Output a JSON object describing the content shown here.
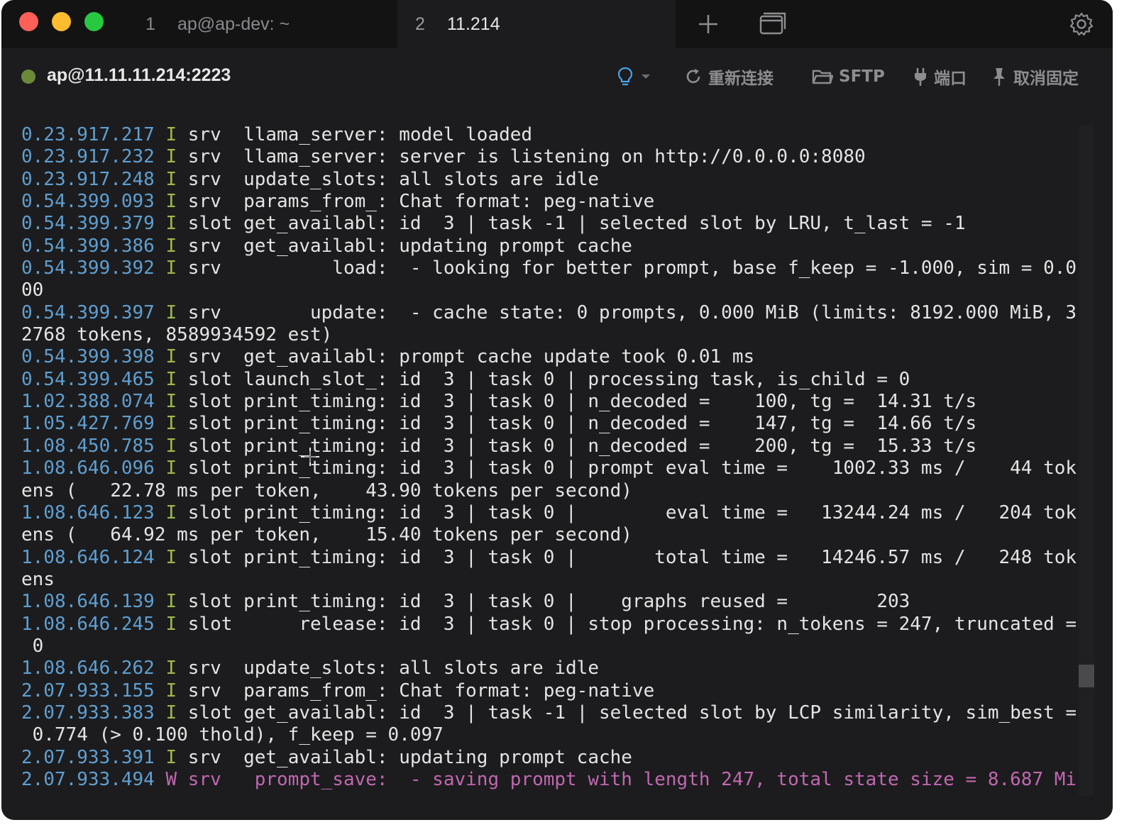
{
  "tabs": [
    {
      "number": "1",
      "title": "ap@ap-dev: ~"
    },
    {
      "number": "2",
      "title": "11.214"
    }
  ],
  "session": {
    "host": "ap@11.11.11.214:2223",
    "status_color": "#6a8a3a"
  },
  "toolbar": {
    "reconnect": "重新连接",
    "sftp": "SFTP",
    "port": "端口",
    "unpin": "取消固定"
  },
  "colors": {
    "timestamp": "#5f9fd1",
    "level_info": "#9fb84a",
    "warning": "#c167b0",
    "text": "#e4e4e4"
  },
  "terminal": {
    "lines": [
      {
        "ts": "0.23.917.217",
        "lvl": "I",
        "msg": " srv  llama_server: model loaded"
      },
      {
        "ts": "0.23.917.232",
        "lvl": "I",
        "msg": " srv  llama_server: server is listening on http://0.0.0.0:8080"
      },
      {
        "ts": "0.23.917.248",
        "lvl": "I",
        "msg": " srv  update_slots: all slots are idle"
      },
      {
        "ts": "0.54.399.093",
        "lvl": "I",
        "msg": " srv  params_from_: Chat format: peg-native"
      },
      {
        "ts": "0.54.399.379",
        "lvl": "I",
        "msg": " slot get_availabl: id  3 | task -1 | selected slot by LRU, t_last = -1"
      },
      {
        "ts": "0.54.399.386",
        "lvl": "I",
        "msg": " srv  get_availabl: updating prompt cache"
      },
      {
        "ts": "0.54.399.392",
        "lvl": "I",
        "msg": " srv          load:  - looking for better prompt, base f_keep = -1.000, sim = 0.0"
      },
      {
        "ts": "",
        "lvl": "",
        "msg": "00"
      },
      {
        "ts": "0.54.399.397",
        "lvl": "I",
        "msg": " srv        update:  - cache state: 0 prompts, 0.000 MiB (limits: 8192.000 MiB, 3"
      },
      {
        "ts": "",
        "lvl": "",
        "msg": "2768 tokens, 8589934592 est)"
      },
      {
        "ts": "0.54.399.398",
        "lvl": "I",
        "msg": " srv  get_availabl: prompt cache update took 0.01 ms"
      },
      {
        "ts": "0.54.399.465",
        "lvl": "I",
        "msg": " slot launch_slot_: id  3 | task 0 | processing task, is_child = 0"
      },
      {
        "ts": "1.02.388.074",
        "lvl": "I",
        "msg": " slot print_timing: id  3 | task 0 | n_decoded =    100, tg =  14.31 t/s"
      },
      {
        "ts": "1.05.427.769",
        "lvl": "I",
        "msg": " slot print_timing: id  3 | task 0 | n_decoded =    147, tg =  14.66 t/s"
      },
      {
        "ts": "1.08.450.785",
        "lvl": "I",
        "msg": " slot print_timing: id  3 | task 0 | n_decoded =    200, tg =  15.33 t/s"
      },
      {
        "ts": "1.08.646.096",
        "lvl": "I",
        "msg": " slot print_timing: id  3 | task 0 | prompt eval time =    1002.33 ms /    44 tok"
      },
      {
        "ts": "",
        "lvl": "",
        "msg": "ens (   22.78 ms per token,    43.90 tokens per second)"
      },
      {
        "ts": "1.08.646.123",
        "lvl": "I",
        "msg": " slot print_timing: id  3 | task 0 |        eval time =   13244.24 ms /   204 tok"
      },
      {
        "ts": "",
        "lvl": "",
        "msg": "ens (   64.92 ms per token,    15.40 tokens per second)"
      },
      {
        "ts": "1.08.646.124",
        "lvl": "I",
        "msg": " slot print_timing: id  3 | task 0 |       total time =   14246.57 ms /   248 tok"
      },
      {
        "ts": "",
        "lvl": "",
        "msg": "ens"
      },
      {
        "ts": "1.08.646.139",
        "lvl": "I",
        "msg": " slot print_timing: id  3 | task 0 |    graphs reused =        203"
      },
      {
        "ts": "1.08.646.245",
        "lvl": "I",
        "msg": " slot      release: id  3 | task 0 | stop processing: n_tokens = 247, truncated ="
      },
      {
        "ts": "",
        "lvl": "",
        "msg": " 0"
      },
      {
        "ts": "1.08.646.262",
        "lvl": "I",
        "msg": " srv  update_slots: all slots are idle"
      },
      {
        "ts": "2.07.933.155",
        "lvl": "I",
        "msg": " srv  params_from_: Chat format: peg-native"
      },
      {
        "ts": "2.07.933.383",
        "lvl": "I",
        "msg": " slot get_availabl: id  3 | task -1 | selected slot by LCP similarity, sim_best ="
      },
      {
        "ts": "",
        "lvl": "",
        "msg": " 0.774 (> 0.100 thold), f_keep = 0.097"
      },
      {
        "ts": "2.07.933.391",
        "lvl": "I",
        "msg": " srv  get_availabl: updating prompt cache"
      },
      {
        "ts": "2.07.933.494",
        "lvl": "W",
        "msg": " srv   prompt_save:  - saving prompt with length 247, total state size = 8.687 Mi"
      }
    ]
  },
  "icons": {
    "add_tab": "plus-icon",
    "tab_overview": "window-stack-icon",
    "settings": "gear-icon",
    "bulb": "lightbulb-icon",
    "reconnect": "refresh-icon",
    "sftp": "folder-icon",
    "port": "plug-icon",
    "unpin": "pin-icon",
    "cursor": "crosshair-cursor-icon"
  }
}
